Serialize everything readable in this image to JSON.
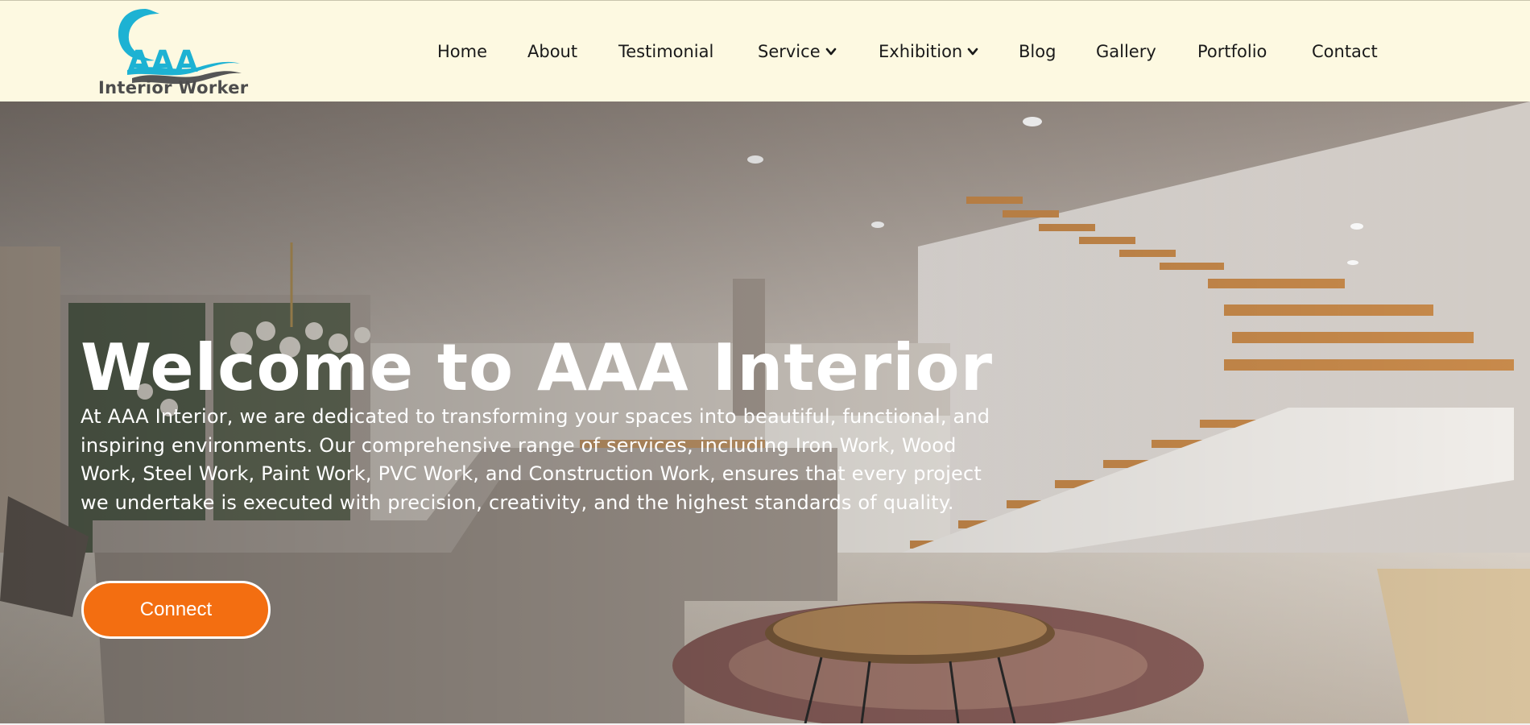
{
  "brand": {
    "logo_text": "AAA",
    "tagline": "Interior Worker",
    "colors": {
      "logo_blue": "#1db2d3",
      "logo_gray": "#4d4d4d",
      "header_bg": "#fdf9e1"
    }
  },
  "nav": {
    "items": [
      {
        "label": "Home"
      },
      {
        "label": "About"
      },
      {
        "label": "Testimonial"
      },
      {
        "label": "Service",
        "icon": "chevron-down-icon"
      },
      {
        "label": "Exhibition",
        "icon": "chevron-down-icon"
      },
      {
        "label": "Blog"
      },
      {
        "label": "Gallery"
      },
      {
        "label": "Portfolio"
      },
      {
        "label": "Contact"
      }
    ]
  },
  "hero": {
    "title": "Welcome to AAA Interior",
    "description": "At AAA Interior, we are dedicated to transforming your spaces into beautiful, functional, and inspiring environments. Our comprehensive range of services, including Iron Work, Wood Work, Steel Work, Paint Work, PVC Work, and Construction Work, ensures that every project we undertake is executed with precision, creativity, and the highest standards of quality.",
    "button_label": "Connect",
    "colors": {
      "button": "#f36e11",
      "text": "#ffffff"
    }
  }
}
